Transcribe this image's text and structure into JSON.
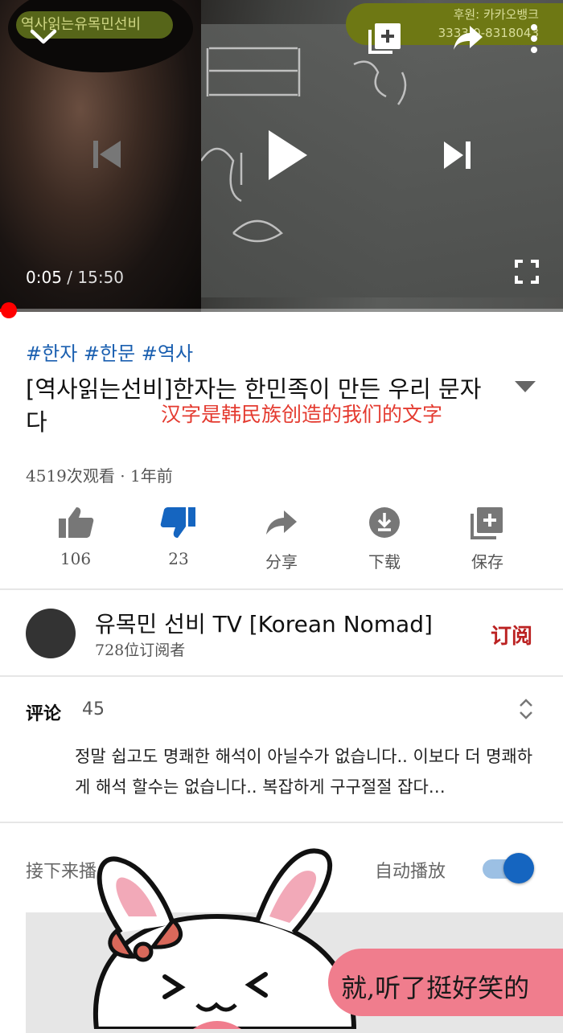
{
  "player": {
    "channel_overlay": "역사읽는유목민선비",
    "sponsor_line1": "후원: 카카오뱅크",
    "sponsor_line2": "3333-0-8318043",
    "current_time": "0:05",
    "separator": " / ",
    "duration": "15:50",
    "progress": 0.005,
    "icons": [
      "chevron-down-icon",
      "add-to-playlist-icon",
      "share-icon",
      "more-vert-icon",
      "skip-previous-icon",
      "play-icon",
      "skip-next-icon",
      "fullscreen-icon"
    ]
  },
  "video": {
    "hashtags": "#한자 #한문 #역사",
    "title": "[역사읽는선비]한자는 한민족이 만든 우리 문자다",
    "annotation": "汉字是韩民族创造的我们的文字",
    "views": "4519次观看",
    "dot": " · ",
    "age": "1年前"
  },
  "actions": [
    {
      "icon": "thumb-up-icon",
      "label": "106"
    },
    {
      "icon": "thumb-down-icon",
      "label": "23"
    },
    {
      "icon": "share-icon",
      "label": "分享"
    },
    {
      "icon": "download-icon",
      "label": "下载"
    },
    {
      "icon": "save-playlist-icon",
      "label": "保存"
    }
  ],
  "channel": {
    "name": "유목민 선비 TV [Korean Nomad]",
    "subscribers": "728位订阅者",
    "subscribe_label": "订阅"
  },
  "comments": {
    "label": "评论",
    "count": "45",
    "top_comment": "정말 쉽고도 명쾌한 해석이 아닐수가 없습니다..  이보다 더 명쾌하게 해석 할수는 없습니다.. 복잡하게 구구절절 잡다…"
  },
  "up_next": {
    "label": "接下来播",
    "autoplay_label": "自动播放",
    "autoplay": true
  },
  "sticker": {
    "text": "就,听了挺好笑的"
  },
  "colors": {
    "accent_blue": "#1565c0",
    "hashtag_blue": "#1a5fb0",
    "progress_red": "#ff0000",
    "annotation_red": "#e43a2f",
    "sticker_pink": "#f07d8d"
  }
}
